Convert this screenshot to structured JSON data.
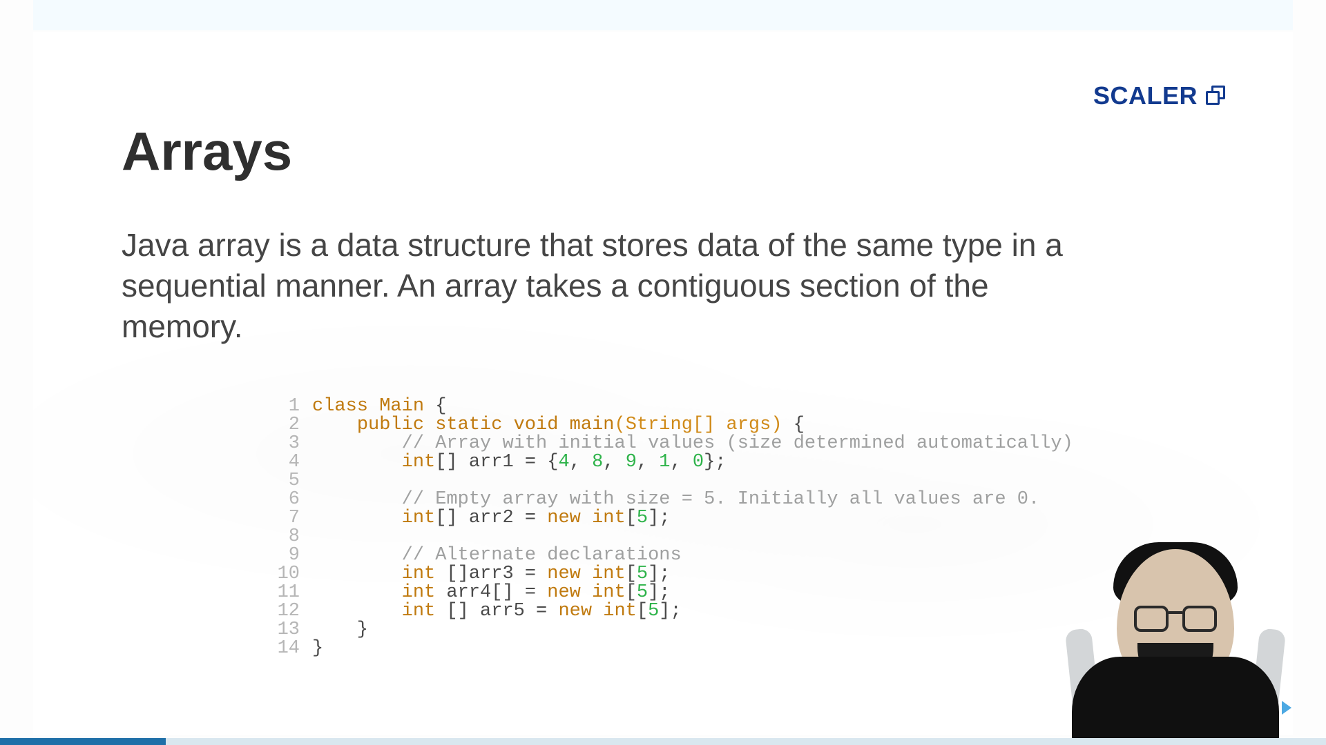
{
  "brand": {
    "name": "SCALER"
  },
  "title": "Arrays",
  "description": "Java array is a data structure that stores data of the same type in a sequential manner. An array takes a contiguous section of the memory.",
  "progress_percent": 12.5,
  "colors": {
    "brand": "#123a8f",
    "progress": "#1e6fa8"
  },
  "code": {
    "lines": [
      {
        "n": 1,
        "tokens": [
          {
            "t": "class",
            "c": "t-kw"
          },
          {
            "t": " "
          },
          {
            "t": "Main",
            "c": "t-cls"
          },
          {
            "t": " {",
            "c": "t-punc"
          }
        ]
      },
      {
        "n": 2,
        "tokens": [
          {
            "t": "    "
          },
          {
            "t": "public",
            "c": "t-kw"
          },
          {
            "t": " "
          },
          {
            "t": "static",
            "c": "t-kw"
          },
          {
            "t": " "
          },
          {
            "t": "void",
            "c": "t-kw"
          },
          {
            "t": " "
          },
          {
            "t": "main",
            "c": "t-fn"
          },
          {
            "t": "(",
            "c": "t-paren"
          },
          {
            "t": "String[] args",
            "c": "t-param"
          },
          {
            "t": ")",
            "c": "t-paren"
          },
          {
            "t": " {",
            "c": "t-punc"
          }
        ]
      },
      {
        "n": 3,
        "tokens": [
          {
            "t": "        "
          },
          {
            "t": "// Array with initial values (size determined automatically)",
            "c": "t-cmt"
          }
        ]
      },
      {
        "n": 4,
        "tokens": [
          {
            "t": "        "
          },
          {
            "t": "int",
            "c": "t-kw"
          },
          {
            "t": "[] arr1 = {",
            "c": "t-punc"
          },
          {
            "t": "4",
            "c": "t-num"
          },
          {
            "t": ", ",
            "c": "t-punc"
          },
          {
            "t": "8",
            "c": "t-num"
          },
          {
            "t": ", ",
            "c": "t-punc"
          },
          {
            "t": "9",
            "c": "t-num"
          },
          {
            "t": ", ",
            "c": "t-punc"
          },
          {
            "t": "1",
            "c": "t-num"
          },
          {
            "t": ", ",
            "c": "t-punc"
          },
          {
            "t": "0",
            "c": "t-num"
          },
          {
            "t": "};",
            "c": "t-punc"
          }
        ]
      },
      {
        "n": 5,
        "tokens": [
          {
            "t": " "
          }
        ]
      },
      {
        "n": 6,
        "tokens": [
          {
            "t": "        "
          },
          {
            "t": "// Empty array with size = 5. Initially all values are 0.",
            "c": "t-cmt"
          }
        ]
      },
      {
        "n": 7,
        "tokens": [
          {
            "t": "        "
          },
          {
            "t": "int",
            "c": "t-kw"
          },
          {
            "t": "[] arr2 = ",
            "c": "t-punc"
          },
          {
            "t": "new",
            "c": "t-kw"
          },
          {
            "t": " ",
            "c": "t-punc"
          },
          {
            "t": "int",
            "c": "t-kw"
          },
          {
            "t": "[",
            "c": "t-punc"
          },
          {
            "t": "5",
            "c": "t-num"
          },
          {
            "t": "];",
            "c": "t-punc"
          }
        ]
      },
      {
        "n": 8,
        "tokens": [
          {
            "t": " "
          }
        ]
      },
      {
        "n": 9,
        "tokens": [
          {
            "t": "        "
          },
          {
            "t": "// Alternate declarations",
            "c": "t-cmt"
          }
        ]
      },
      {
        "n": 10,
        "tokens": [
          {
            "t": "        "
          },
          {
            "t": "int",
            "c": "t-kw"
          },
          {
            "t": " []arr3 = ",
            "c": "t-punc"
          },
          {
            "t": "new",
            "c": "t-kw"
          },
          {
            "t": " ",
            "c": "t-punc"
          },
          {
            "t": "int",
            "c": "t-kw"
          },
          {
            "t": "[",
            "c": "t-punc"
          },
          {
            "t": "5",
            "c": "t-num"
          },
          {
            "t": "];",
            "c": "t-punc"
          }
        ]
      },
      {
        "n": 11,
        "tokens": [
          {
            "t": "        "
          },
          {
            "t": "int",
            "c": "t-kw"
          },
          {
            "t": " arr4[] = ",
            "c": "t-punc"
          },
          {
            "t": "new",
            "c": "t-kw"
          },
          {
            "t": " ",
            "c": "t-punc"
          },
          {
            "t": "int",
            "c": "t-kw"
          },
          {
            "t": "[",
            "c": "t-punc"
          },
          {
            "t": "5",
            "c": "t-num"
          },
          {
            "t": "];",
            "c": "t-punc"
          }
        ]
      },
      {
        "n": 12,
        "tokens": [
          {
            "t": "        "
          },
          {
            "t": "int",
            "c": "t-kw"
          },
          {
            "t": " [] arr5 = ",
            "c": "t-punc"
          },
          {
            "t": "new",
            "c": "t-kw"
          },
          {
            "t": " ",
            "c": "t-punc"
          },
          {
            "t": "int",
            "c": "t-kw"
          },
          {
            "t": "[",
            "c": "t-punc"
          },
          {
            "t": "5",
            "c": "t-num"
          },
          {
            "t": "];",
            "c": "t-punc"
          }
        ]
      },
      {
        "n": 13,
        "tokens": [
          {
            "t": "    }",
            "c": "t-punc"
          }
        ]
      },
      {
        "n": 14,
        "tokens": [
          {
            "t": "}",
            "c": "t-punc"
          }
        ]
      }
    ]
  }
}
